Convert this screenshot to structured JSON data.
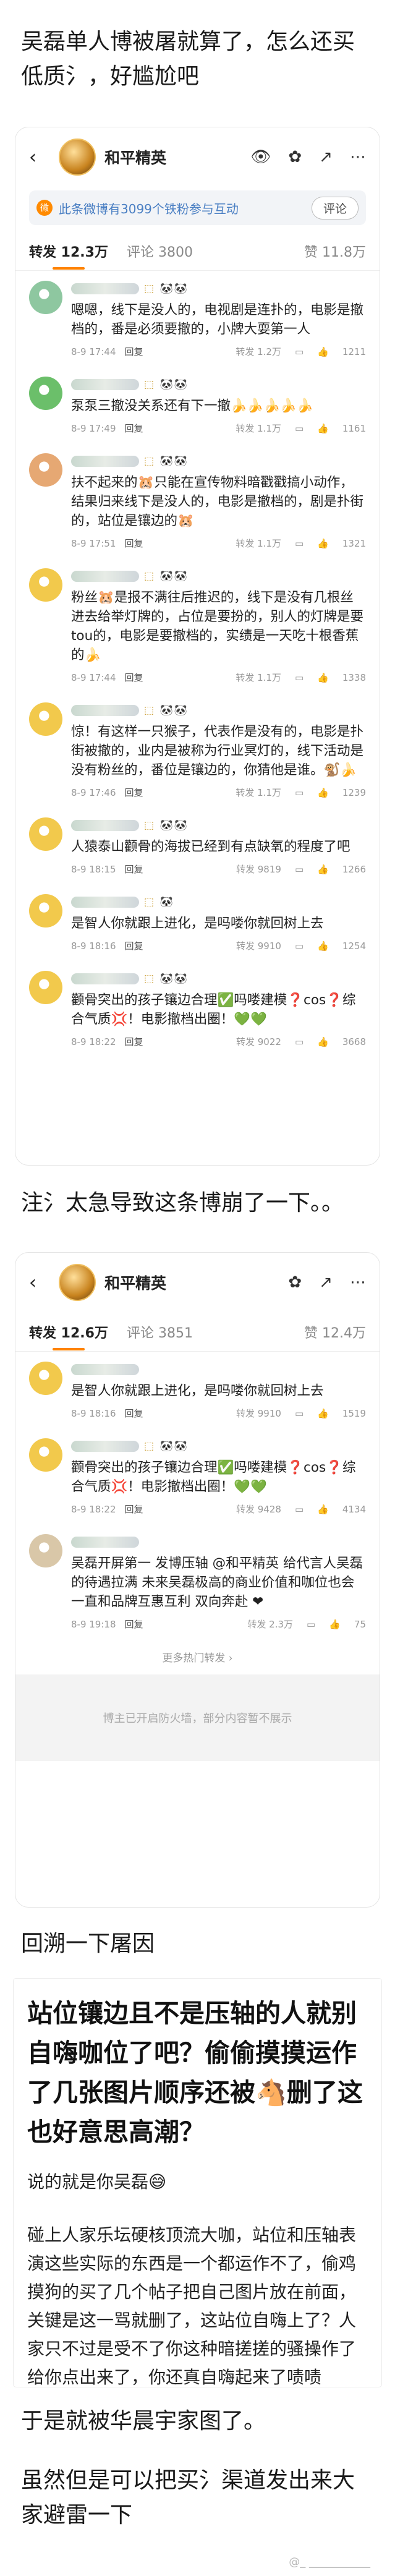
{
  "article": {
    "title": "吴磊单人博被屠就算了，怎么还买低质氵，好尴尬吧",
    "note1": "注氵太急导致这条博崩了一下。。",
    "subtitle": "回溯一下屠因",
    "closing": "于是就被华晨宇家图了。",
    "last": "虽然但是可以把买氵渠道发出来大家避雷一下",
    "watermark": "@_ ___________"
  },
  "screen1": {
    "header": {
      "back": "‹",
      "name": "和平精英",
      "icons": [
        "eye-icon",
        "flower-icon",
        "share-icon",
        "more-icon"
      ]
    },
    "banner": {
      "text": "此条微博有3099个铁粉参与互动",
      "button": "评论"
    },
    "tabs": {
      "repost": "转发 12.3万",
      "comment": "评论 3800",
      "likes": "赞 11.8万"
    },
    "comments": [
      {
        "badges": "⬚ 🐼🐼",
        "text": "嗯嗯，线下是没人的，电视剧是连扑的，电影是撤档的，番是必须要撤的，小牌大耍第一人",
        "time": "8-9 17:44",
        "loc": "来自",
        "reply": "回复",
        "repost": "转发 1.2万",
        "likes": "1211",
        "avatar": "#8ec7a0"
      },
      {
        "badges": "⬚ 🐼🐼",
        "text": "泵泵三撤没关系还有下一撤🍌🍌🍌🍌🍌",
        "time": "8-9 17:49",
        "loc": "",
        "reply": "回复",
        "repost": "转发 1.1万",
        "likes": "1161",
        "avatar": "#6bbf6a"
      },
      {
        "badges": "⬚ 🐼🐼",
        "text": "扶不起来的🐹只能在宣传物料暗戳戳搞小动作，结果归来线下是没人的，电影是撤档的，剧是扑街的，站位是镶边的🐹",
        "time": "8-9 17:51",
        "loc": "",
        "reply": "回复",
        "repost": "转发 1.1万",
        "likes": "1321",
        "avatar": "#e6a873"
      },
      {
        "badges": "⬚ 🐼🐼",
        "text": "粉丝🐹是报不满往后推迟的，线下是没有几根丝进去给举灯牌的，占位是要扮的，别人的灯牌是要tou的，电影是要撤档的，实绩是一天吃十根香蕉的🍌",
        "time": "8-9 17:44",
        "loc": "",
        "reply": "回复",
        "repost": "转发 1.1万",
        "likes": "1338",
        "avatar": "#f2c94c"
      },
      {
        "badges": "⬚ 🐼🐼",
        "text": "惊！有这样一只猴子，代表作是没有的，电影是扑街被撤的，业内是被称为行业冥灯的，线下活动是没有粉丝的，番位是镶边的，你猜他是谁。🐒🍌",
        "time": "8-9 17:46",
        "loc": "",
        "reply": "回复",
        "repost": "转发 1.1万",
        "likes": "1239",
        "avatar": "#f2c94c"
      },
      {
        "badges": "⬚ 🐼🐼",
        "text": "人猿泰山颧骨的海拔已经到有点缺氧的程度了吧",
        "time": "8-9 18:15",
        "loc": "",
        "reply": "回复",
        "repost": "转发 9819",
        "likes": "1266",
        "avatar": "#f2c94c"
      },
      {
        "badges": "⬚ 🐼",
        "text": "是智人你就跟上进化，是吗喽你就回树上去",
        "time": "8-9 18:16",
        "loc": "",
        "reply": "回复",
        "repost": "转发 9910",
        "likes": "1254",
        "avatar": "#f2c94c"
      },
      {
        "badges": "⬚ 🐼🐼",
        "text": "颧骨突出的孩子镶边合理✅吗喽建模❓cos❓综合气质💢！电影撤档出圈！💚💚",
        "time": "8-9 18:22",
        "loc": "",
        "reply": "回复",
        "repost": "转发 9022",
        "likes": "3668",
        "avatar": "#f2c94c"
      }
    ]
  },
  "screen2": {
    "header": {
      "back": "‹",
      "name": "和平精英",
      "icons": [
        "flower-icon",
        "share-icon",
        "more-icon"
      ]
    },
    "tabs": {
      "repost": "转发 12.6万",
      "comment": "评论 3851",
      "likes": "赞 12.4万"
    },
    "comments": [
      {
        "badges": "",
        "text": "是智人你就跟上进化，是吗喽你就回树上去",
        "time": "8-9 18:16",
        "loc": "",
        "reply": "回复",
        "repost": "转发 9910",
        "likes": "1519",
        "avatar": "#f2c94c"
      },
      {
        "badges": "⬚ 🐼🐼",
        "text": "颧骨突出的孩子镶边合理✅吗喽建模❓cos❓综合气质💢！电影撤档出圈！💚💚",
        "time": "8-9 18:22",
        "loc": "",
        "reply": "回复",
        "repost": "转发 9428",
        "likes": "4134",
        "avatar": "#f2c94c"
      },
      {
        "badges": "",
        "text": "吴磊开屏第一 发博压轴 @和平精英 给代言人吴磊的待遇拉满 未来吴磊极高的商业价值和咖位也会一直和品牌互惠互利 双向奔赴 ❤",
        "time": "8-9 19:18",
        "loc": "",
        "reply": "回复",
        "repost": "转发 2.3万",
        "likes": "75",
        "avatar": "#d9c7a8"
      }
    ],
    "more_hot": "更多热门转发 ›",
    "blocked": "博主已开启防火墙，部分内容暂不展示"
  },
  "quote": {
    "heading": "站位镶边且不是压轴的人就别自嗨咖位了吧？偷偷摸摸运作了几张图片顺序还被🐴删了这也好意思高潮？",
    "line1": "说的就是你吴磊😅",
    "para": "碰上人家乐坛硬核顶流大咖，站位和压轴表演这些实际的东西是一个都运作不了，偷鸡摸狗的买了几个帖子把自己图片放在前面，关键是这一骂就删了，这站位自嗨上了？人家只不过是受不了你这种暗搓搓的骚操作了给你点出来了，你还真自嗨起来了啧啧"
  }
}
